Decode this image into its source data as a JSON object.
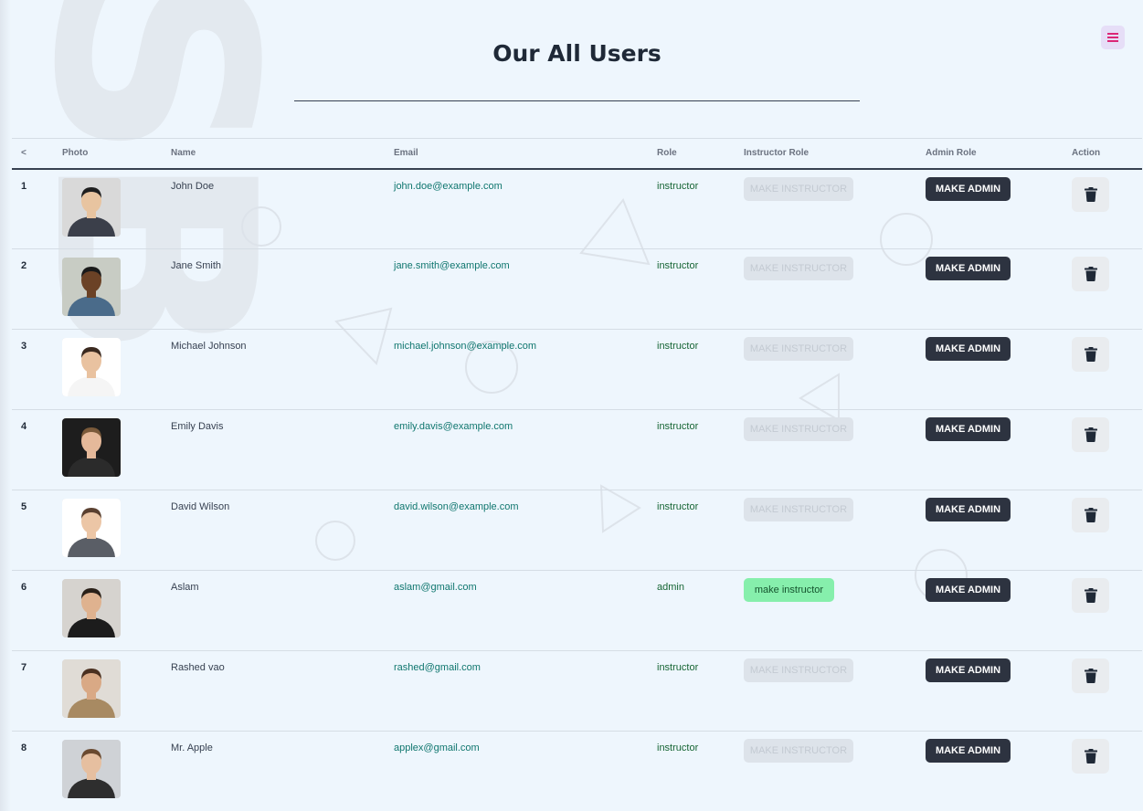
{
  "page": {
    "title": "Our All Users"
  },
  "menu": {
    "icon": "hamburger-icon"
  },
  "table": {
    "headers": [
      "<",
      "Photo",
      "Name",
      "Email",
      "Role",
      "Instructor Role",
      "Admin Role",
      "Action"
    ],
    "rows": [
      {
        "num": "1",
        "name": "John Doe",
        "email": "john.doe@example.com",
        "role": "instructor",
        "instructor_btn": "MAKE INSTRUCTOR",
        "instructor_active": false,
        "admin_btn": "MAKE ADMIN",
        "skin": "#e8c4a0",
        "hair": "#1f1f1f",
        "shirt": "#3b3f4a",
        "bg": "#d9d9d9"
      },
      {
        "num": "2",
        "name": "Jane Smith",
        "email": "jane.smith@example.com",
        "role": "instructor",
        "instructor_btn": "MAKE INSTRUCTOR",
        "instructor_active": false,
        "admin_btn": "MAKE ADMIN",
        "skin": "#6b4226",
        "hair": "#1a1a1a",
        "shirt": "#4a6b8a",
        "bg": "#c8ccc4"
      },
      {
        "num": "3",
        "name": "Michael Johnson",
        "email": "michael.johnson@example.com",
        "role": "instructor",
        "instructor_btn": "MAKE INSTRUCTOR",
        "instructor_active": false,
        "admin_btn": "MAKE ADMIN",
        "skin": "#e9c2a0",
        "hair": "#3b2a20",
        "shirt": "#f5f5f5",
        "bg": "#ffffff"
      },
      {
        "num": "4",
        "name": "Emily Davis",
        "email": "emily.davis@example.com",
        "role": "instructor",
        "instructor_btn": "MAKE INSTRUCTOR",
        "instructor_active": false,
        "admin_btn": "MAKE ADMIN",
        "skin": "#e5b99a",
        "hair": "#7a5a3a",
        "shirt": "#2b2b2b",
        "bg": "#1d1d1d"
      },
      {
        "num": "5",
        "name": "David Wilson",
        "email": "david.wilson@example.com",
        "role": "instructor",
        "instructor_btn": "MAKE INSTRUCTOR",
        "instructor_active": false,
        "admin_btn": "MAKE ADMIN",
        "skin": "#ecc6a6",
        "hair": "#5a4030",
        "shirt": "#5a5e66",
        "bg": "#ffffff"
      },
      {
        "num": "6",
        "name": "Aslam",
        "email": "aslam@gmail.com",
        "role": "admin",
        "instructor_btn": "make instructor",
        "instructor_active": true,
        "admin_btn": "MAKE ADMIN",
        "skin": "#dfb28f",
        "hair": "#2a2018",
        "shirt": "#1c1c1c",
        "bg": "#d6d3cf"
      },
      {
        "num": "7",
        "name": "Rashed vao",
        "email": "rashed@gmail.com",
        "role": "instructor",
        "instructor_btn": "MAKE INSTRUCTOR",
        "instructor_active": false,
        "admin_btn": "MAKE ADMIN",
        "skin": "#d9a985",
        "hair": "#4a3020",
        "shirt": "#a88a62",
        "bg": "#e0dcd6"
      },
      {
        "num": "8",
        "name": "Mr. Apple",
        "email": "applex@gmail.com",
        "role": "instructor",
        "instructor_btn": "MAKE INSTRUCTOR",
        "instructor_active": false,
        "admin_btn": "MAKE ADMIN",
        "skin": "#e6bfa0",
        "hair": "#6a4a30",
        "shirt": "#2e2e2e",
        "bg": "#cfd2d6"
      }
    ]
  },
  "icons": {
    "delete": "trash-icon"
  }
}
